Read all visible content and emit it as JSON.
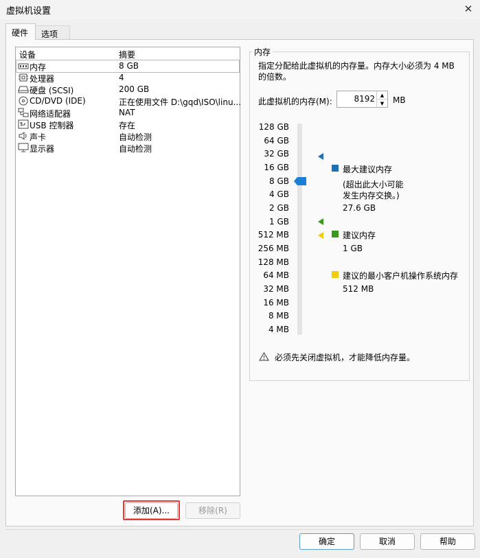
{
  "window": {
    "title": "虚拟机设置",
    "close_glyph": "✕"
  },
  "tabs": [
    {
      "label": "硬件"
    },
    {
      "label": "选项"
    }
  ],
  "device_list": {
    "header_device": "设备",
    "header_summary": "摘要",
    "items": [
      {
        "name": "内存",
        "summary": "8 GB",
        "icon": "memory-icon"
      },
      {
        "name": "处理器",
        "summary": "4",
        "icon": "cpu-icon"
      },
      {
        "name": "硬盘 (SCSI)",
        "summary": "200 GB",
        "icon": "harddisk-icon"
      },
      {
        "name": "CD/DVD (IDE)",
        "summary": "正在使用文件 D:\\gqd\\ISO\\linu...",
        "icon": "cdrom-icon"
      },
      {
        "name": "网络适配器",
        "summary": "NAT",
        "icon": "network-icon"
      },
      {
        "name": "USB 控制器",
        "summary": "存在",
        "icon": "usb-icon"
      },
      {
        "name": "声卡",
        "summary": "自动检测",
        "icon": "speaker-icon"
      },
      {
        "name": "显示器",
        "summary": "自动检测",
        "icon": "monitor-icon"
      }
    ],
    "selected_index": 0,
    "add_button": "添加(A)...",
    "remove_button": "移除(R)"
  },
  "memory": {
    "group_title": "内存",
    "description": "指定分配给此虚拟机的内存量。内存大小必须为 4 MB 的倍数。",
    "field_label": "此虚拟机的内存(M):",
    "value": "8192",
    "unit": "MB",
    "scale_labels": [
      "128 GB",
      "64 GB",
      "32 GB",
      "16 GB",
      "8 GB",
      "4 GB",
      "2 GB",
      "1 GB",
      "512 MB",
      "256 MB",
      "128 MB",
      "64 MB",
      "32 MB",
      "16 MB",
      "8 MB",
      "4 MB"
    ],
    "slider_value": "8 GB",
    "markers": {
      "max_recommended": "32 GB",
      "recommended": "1 GB",
      "min_guest": "512 MB"
    },
    "legend": {
      "max_title": "最大建议内存",
      "max_note_1": "(超出此大小可能",
      "max_note_2": "发生内存交换。)",
      "max_value": "27.6 GB",
      "rec_title": "建议内存",
      "rec_value": "1 GB",
      "min_title": "建议的最小客户机操作系统内存",
      "min_value": "512 MB"
    },
    "warning": "必须先关闭虚拟机，才能降低内存量。"
  },
  "colors": {
    "max": "#1f6fb8",
    "rec": "#3a9a1f",
    "min": "#f2cc0c",
    "thumb": "#1a7fd4",
    "highlight": "#e53935"
  },
  "footer": {
    "ok": "确定",
    "cancel": "取消",
    "help": "帮助"
  }
}
